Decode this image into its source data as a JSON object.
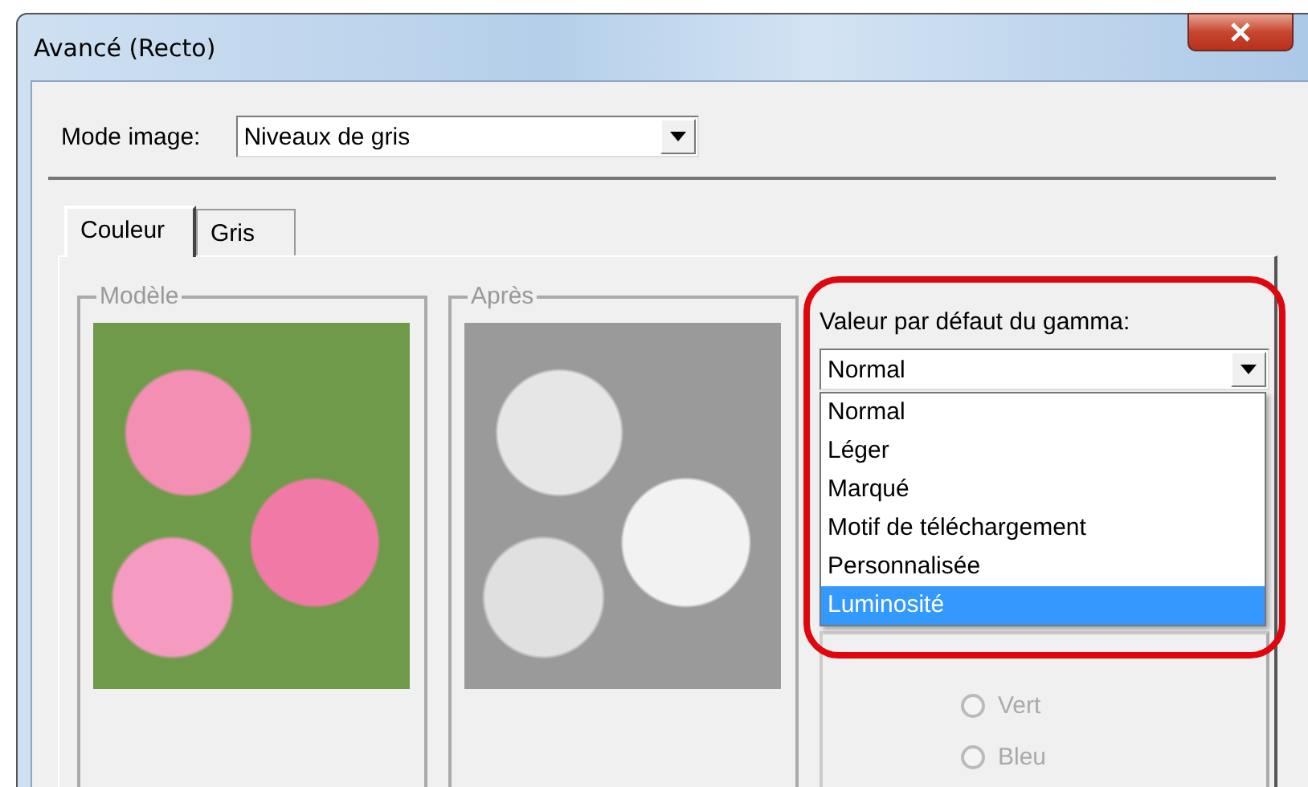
{
  "window": {
    "title": "Avancé (Recto)"
  },
  "mode_image": {
    "label": "Mode image:",
    "value": "Niveaux de gris"
  },
  "tabs": [
    {
      "label": "Couleur",
      "selected": true
    },
    {
      "label": "Gris",
      "selected": false
    }
  ],
  "preview_groups": [
    {
      "title": "Modèle",
      "kind": "color"
    },
    {
      "title": "Après",
      "kind": "gray"
    }
  ],
  "gamma": {
    "label": "Valeur par défaut du gamma:",
    "value": "Normal",
    "expanded": true,
    "options": [
      {
        "label": "Normal",
        "highlighted": false
      },
      {
        "label": "Léger",
        "highlighted": false
      },
      {
        "label": "Marqué",
        "highlighted": false
      },
      {
        "label": "Motif de téléchargement",
        "highlighted": false
      },
      {
        "label": "Personnalisée",
        "highlighted": false
      },
      {
        "label": "Luminosité",
        "highlighted": true
      }
    ]
  },
  "channels": [
    {
      "label": "Vert",
      "selected": false,
      "disabled": true
    },
    {
      "label": "Bleu",
      "selected": false,
      "disabled": true
    }
  ]
}
